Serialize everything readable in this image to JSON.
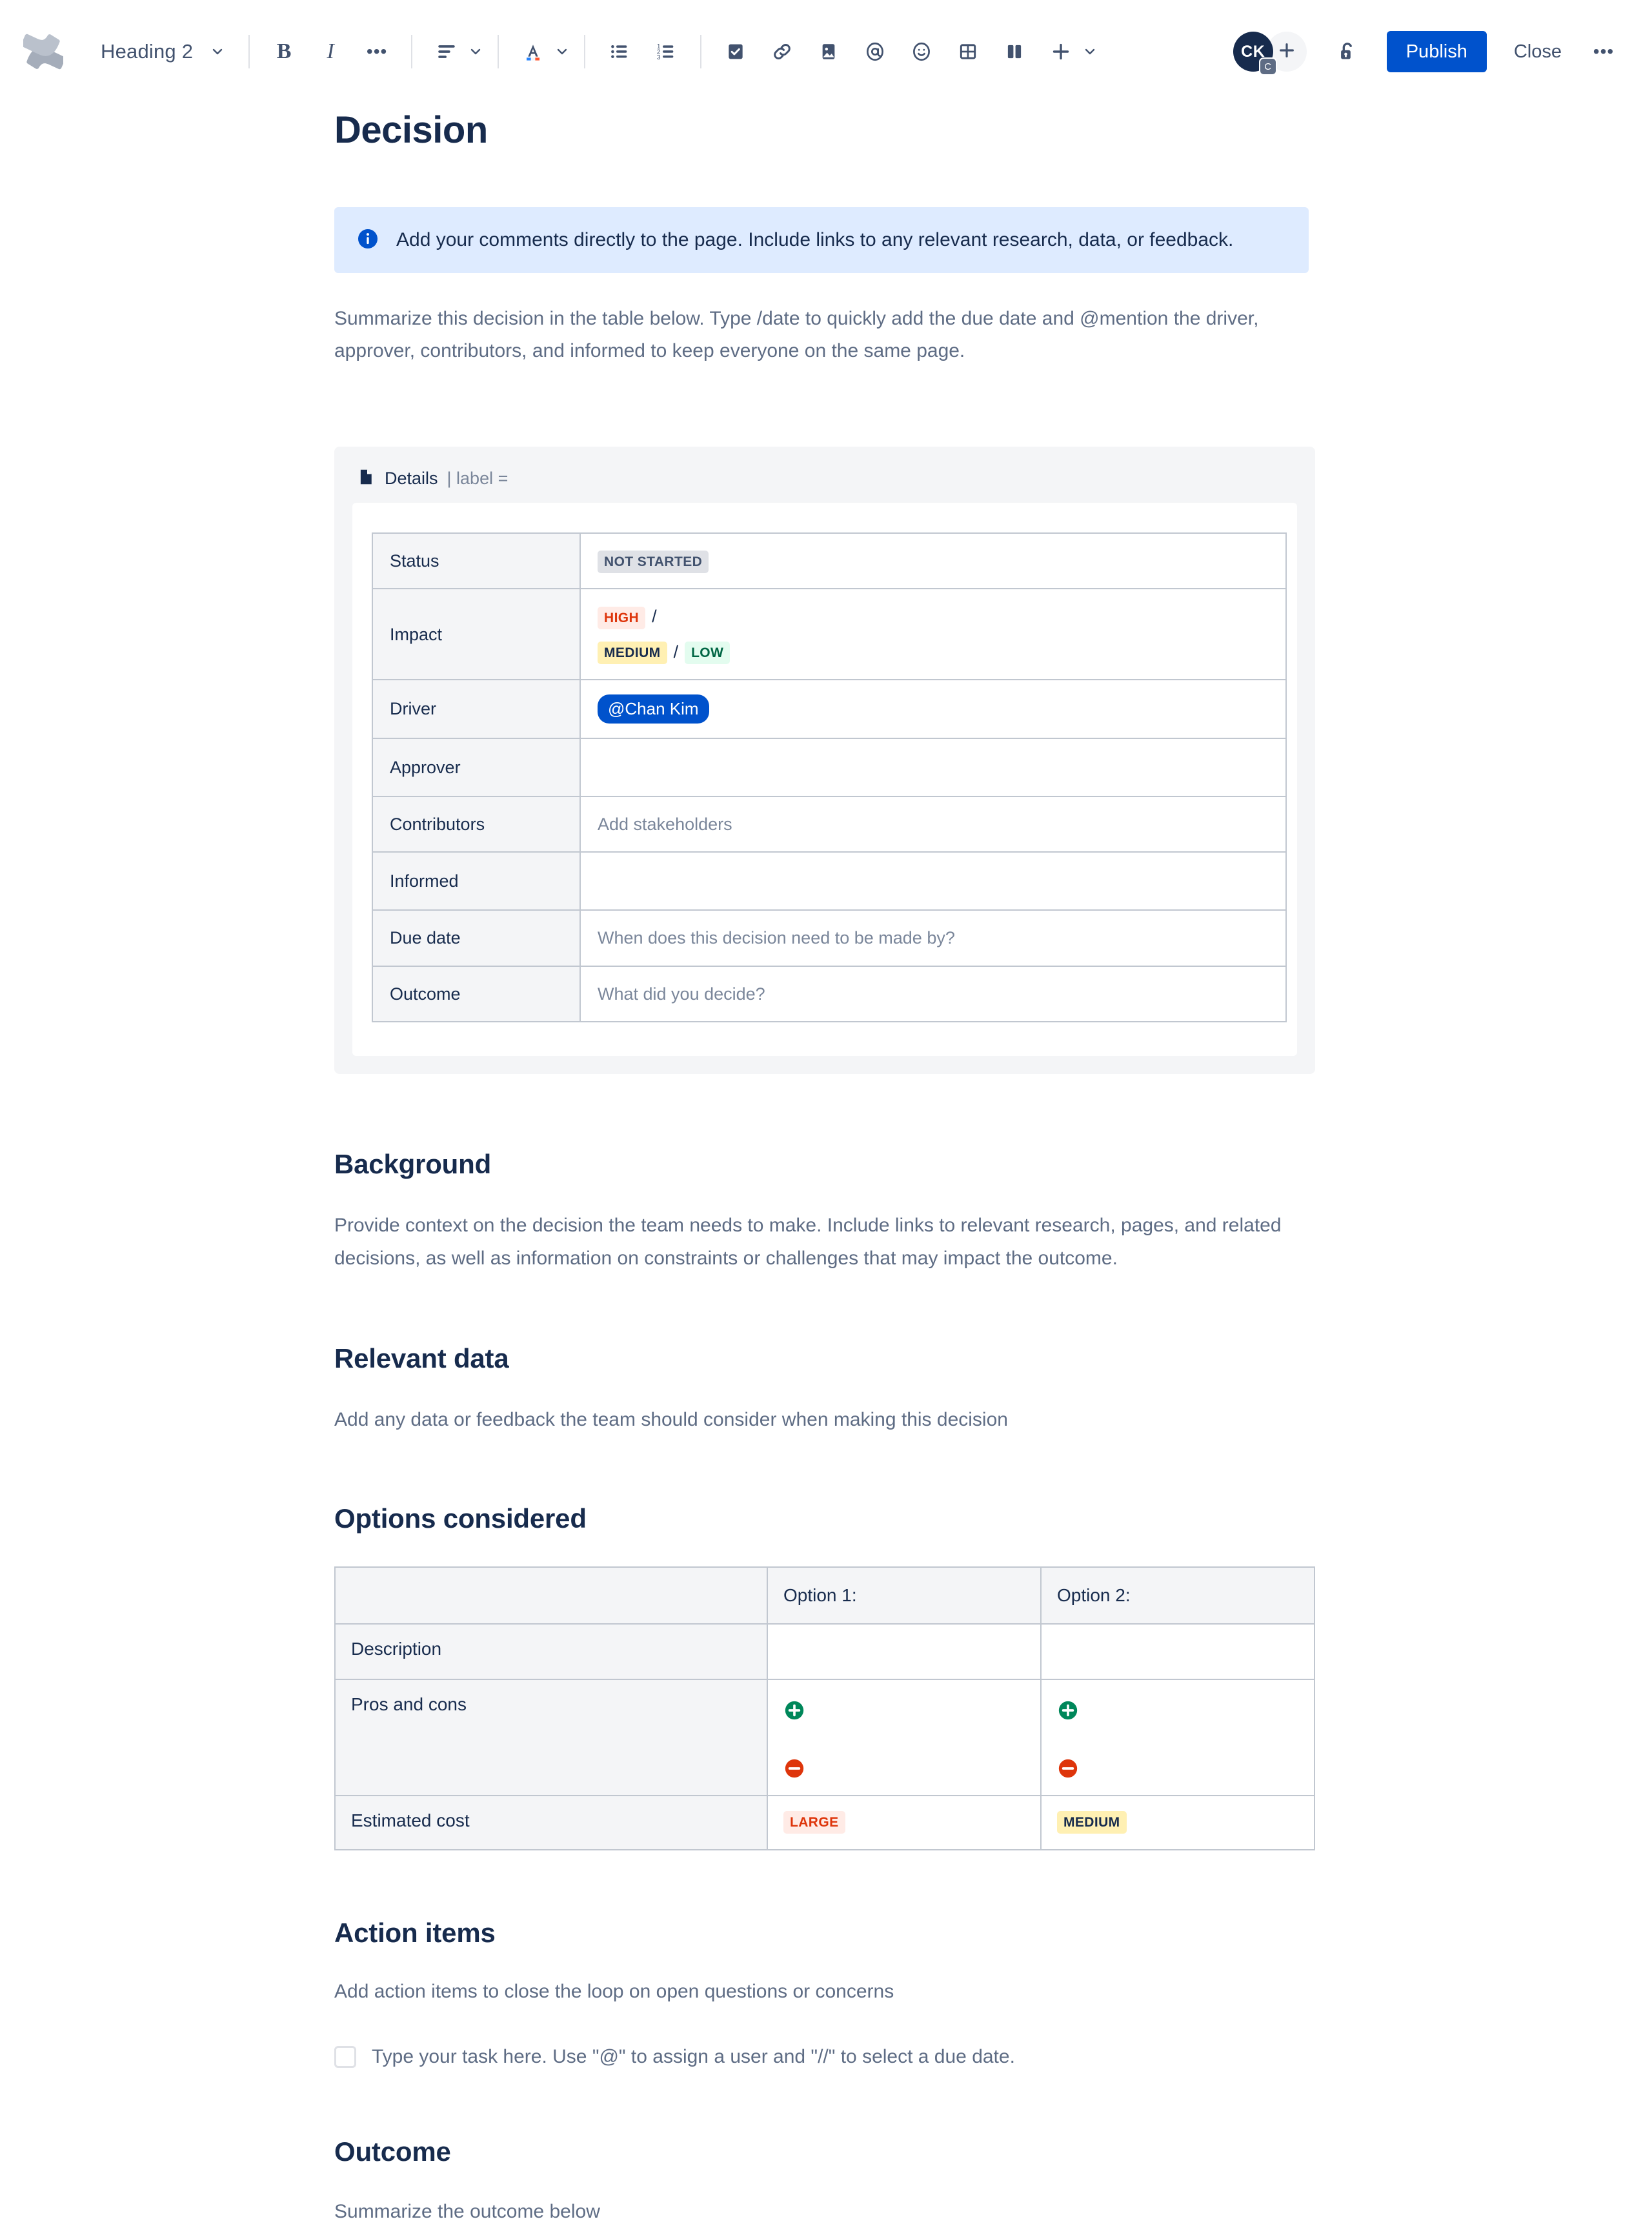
{
  "toolbar": {
    "logo_icon": "confluence-logo-icon",
    "style_select": {
      "label": "Heading 2",
      "icon": "chevron-down-icon"
    },
    "bold_label": "B",
    "italic_label": "I",
    "more_formatting_label": "•••",
    "align_icon": "text-align-left-icon",
    "text_color_icon": "text-color-icon",
    "bullet_list_icon": "bullet-list-icon",
    "numbered_list_icon": "numbered-list-icon",
    "task_icon": "checkbox-task-icon",
    "link_icon": "link-icon",
    "image_icon": "image-icon",
    "mention_icon": "mention-at-icon",
    "emoji_icon": "emoji-smiley-icon",
    "table_icon": "table-icon",
    "layout_icon": "page-layout-icon",
    "insert_icon": "plus-insert-icon",
    "avatar": {
      "initials": "CK",
      "badge": "C"
    },
    "add_people_icon": "plus-icon",
    "restrictions_icon": "unlocked-padlock-icon",
    "publish_label": "Publish",
    "close_label": "Close",
    "more_actions_label": "•••"
  },
  "page": {
    "title": "Decision",
    "info_banner": {
      "icon": "info-circle-icon",
      "text": "Add your comments directly to the page. Include links to any relevant research, data, or feedback."
    },
    "intro_paragraph": "Summarize this decision in the table below. Type /date to quickly add the due date and @mention the driver, approver, contributors, and informed to keep everyone on the same page."
  },
  "details_macro": {
    "icon": "page-details-icon",
    "title": "Details",
    "meta": "| label =",
    "rows": [
      {
        "label": "Status",
        "value_type": "lozenge",
        "lozenges": [
          {
            "text": "NOT STARTED",
            "style": "default"
          }
        ]
      },
      {
        "label": "Impact",
        "value_type": "lozenge_multiline",
        "line1": [
          {
            "text": "HIGH",
            "style": "red"
          }
        ],
        "line1_sep": "/",
        "line2": [
          {
            "text": "MEDIUM",
            "style": "yellow"
          },
          {
            "text": "LOW",
            "style": "green"
          }
        ],
        "line2_sep": "/"
      },
      {
        "label": "Driver",
        "value_type": "mention",
        "mention": "@Chan Kim"
      },
      {
        "label": "Approver",
        "value_type": "empty",
        "value": ""
      },
      {
        "label": "Contributors",
        "value_type": "placeholder",
        "value": "Add stakeholders"
      },
      {
        "label": "Informed",
        "value_type": "empty",
        "value": ""
      },
      {
        "label": "Due date",
        "value_type": "placeholder",
        "value": "When does this decision need to be made by?"
      },
      {
        "label": "Outcome",
        "value_type": "placeholder",
        "value": "What did you decide?"
      }
    ]
  },
  "sections": {
    "background": {
      "heading": "Background",
      "body": "Provide context on the decision the team needs to make. Include links to relevant research, pages, and related decisions, as well as information on constraints or challenges that may impact the outcome."
    },
    "relevant_data": {
      "heading": "Relevant data",
      "body": "Add any data or feedback the team should consider when making this decision"
    },
    "options_considered": {
      "heading": "Options considered",
      "table": {
        "headers": [
          "",
          "Option 1:",
          "Option 2:"
        ],
        "rows": [
          {
            "label": "Description",
            "option1": "",
            "option2": ""
          },
          {
            "label": "Pros and cons",
            "option1_pro_icon": "plus-circle-icon",
            "option1_con_icon": "minus-circle-icon",
            "option2_pro_icon": "plus-circle-icon",
            "option2_con_icon": "minus-circle-icon"
          },
          {
            "label": "Estimated cost",
            "option1_lozenge": {
              "text": "LARGE",
              "style": "red"
            },
            "option2_lozenge": {
              "text": "MEDIUM",
              "style": "yellow"
            }
          }
        ]
      }
    },
    "action_items": {
      "heading": "Action items",
      "body": "Add action items to close the loop on open questions or concerns",
      "task_placeholder": "Type your task here. Use \"@\" to assign a user and \"//\" to select a due date.",
      "task_checked": false
    },
    "outcome": {
      "heading": "Outcome",
      "body": "Summarize the outcome below"
    }
  },
  "colors": {
    "brand_blue": "#0052CC",
    "info_bg": "#DEEBFF",
    "panel_bg": "#F4F5F7",
    "border": "#C1C7D0",
    "text": "#172B4D",
    "subtle_text": "#5E6C84",
    "placeholder": "#7A869A",
    "pro_green": "#00875A",
    "con_red": "#DE350B"
  }
}
